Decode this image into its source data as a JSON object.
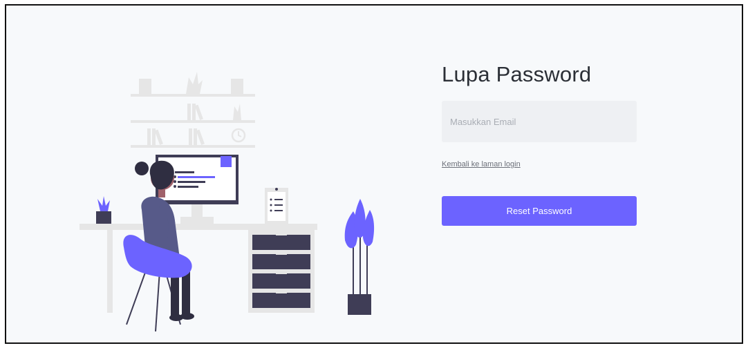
{
  "form": {
    "title": "Lupa Password",
    "email_placeholder": "Masukkan Email",
    "email_value": "",
    "back_link_label": "Kembali ke laman login",
    "reset_button_label": "Reset Password"
  },
  "illustration": {
    "icon": "person-at-desk-illustration",
    "accent_color": "#6c63ff",
    "dark_color": "#3f3d56",
    "light_color": "#e6e6e6"
  }
}
